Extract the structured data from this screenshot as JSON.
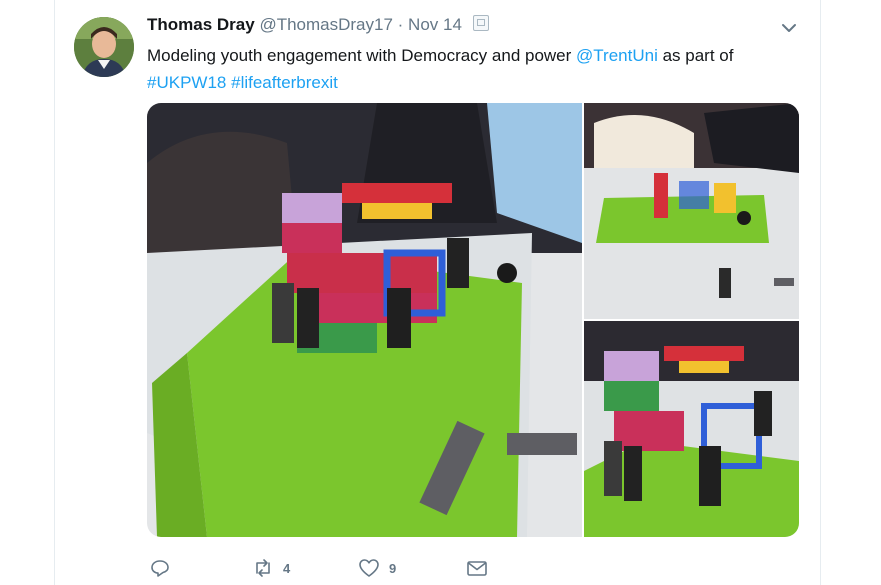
{
  "tweet": {
    "author_name": "Thomas Dray",
    "author_handle": "@ThomasDray17",
    "separator": "·",
    "timestamp": "Nov 14",
    "text_main": "Modeling youth engagement with Democracy and power ",
    "mention": "@TrentUni",
    "text_tail": " as part of",
    "hashtag_1": "#UKPW18",
    "hashtag_2": "#lifeafterbrexit"
  },
  "media": {
    "count": 3,
    "descriptions": [
      "lego-model-main",
      "lego-model-top",
      "lego-model-side"
    ]
  },
  "actions": {
    "reply_count": "",
    "retweet_count": "4",
    "like_count": "9"
  },
  "icons": {
    "reply": "reply-icon",
    "retweet": "retweet-icon",
    "like": "heart-icon",
    "message": "envelope-icon",
    "menu": "chevron-down-icon"
  },
  "colors": {
    "link": "#1da1f2",
    "muted": "#657786",
    "lego_green": "#7bc62d"
  }
}
